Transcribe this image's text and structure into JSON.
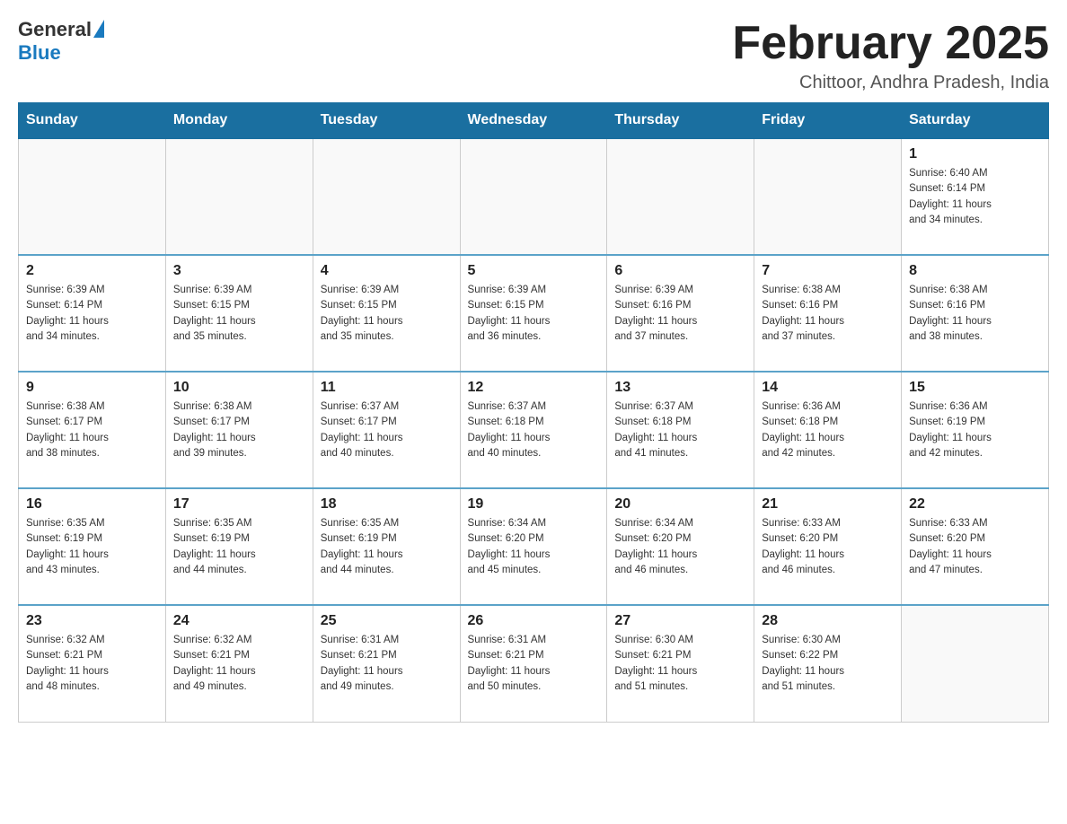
{
  "header": {
    "logo_general": "General",
    "logo_blue": "Blue",
    "title": "February 2025",
    "subtitle": "Chittoor, Andhra Pradesh, India"
  },
  "days_of_week": [
    "Sunday",
    "Monday",
    "Tuesday",
    "Wednesday",
    "Thursday",
    "Friday",
    "Saturday"
  ],
  "weeks": [
    [
      {
        "day": "",
        "info": ""
      },
      {
        "day": "",
        "info": ""
      },
      {
        "day": "",
        "info": ""
      },
      {
        "day": "",
        "info": ""
      },
      {
        "day": "",
        "info": ""
      },
      {
        "day": "",
        "info": ""
      },
      {
        "day": "1",
        "info": "Sunrise: 6:40 AM\nSunset: 6:14 PM\nDaylight: 11 hours\nand 34 minutes."
      }
    ],
    [
      {
        "day": "2",
        "info": "Sunrise: 6:39 AM\nSunset: 6:14 PM\nDaylight: 11 hours\nand 34 minutes."
      },
      {
        "day": "3",
        "info": "Sunrise: 6:39 AM\nSunset: 6:15 PM\nDaylight: 11 hours\nand 35 minutes."
      },
      {
        "day": "4",
        "info": "Sunrise: 6:39 AM\nSunset: 6:15 PM\nDaylight: 11 hours\nand 35 minutes."
      },
      {
        "day": "5",
        "info": "Sunrise: 6:39 AM\nSunset: 6:15 PM\nDaylight: 11 hours\nand 36 minutes."
      },
      {
        "day": "6",
        "info": "Sunrise: 6:39 AM\nSunset: 6:16 PM\nDaylight: 11 hours\nand 37 minutes."
      },
      {
        "day": "7",
        "info": "Sunrise: 6:38 AM\nSunset: 6:16 PM\nDaylight: 11 hours\nand 37 minutes."
      },
      {
        "day": "8",
        "info": "Sunrise: 6:38 AM\nSunset: 6:16 PM\nDaylight: 11 hours\nand 38 minutes."
      }
    ],
    [
      {
        "day": "9",
        "info": "Sunrise: 6:38 AM\nSunset: 6:17 PM\nDaylight: 11 hours\nand 38 minutes."
      },
      {
        "day": "10",
        "info": "Sunrise: 6:38 AM\nSunset: 6:17 PM\nDaylight: 11 hours\nand 39 minutes."
      },
      {
        "day": "11",
        "info": "Sunrise: 6:37 AM\nSunset: 6:17 PM\nDaylight: 11 hours\nand 40 minutes."
      },
      {
        "day": "12",
        "info": "Sunrise: 6:37 AM\nSunset: 6:18 PM\nDaylight: 11 hours\nand 40 minutes."
      },
      {
        "day": "13",
        "info": "Sunrise: 6:37 AM\nSunset: 6:18 PM\nDaylight: 11 hours\nand 41 minutes."
      },
      {
        "day": "14",
        "info": "Sunrise: 6:36 AM\nSunset: 6:18 PM\nDaylight: 11 hours\nand 42 minutes."
      },
      {
        "day": "15",
        "info": "Sunrise: 6:36 AM\nSunset: 6:19 PM\nDaylight: 11 hours\nand 42 minutes."
      }
    ],
    [
      {
        "day": "16",
        "info": "Sunrise: 6:35 AM\nSunset: 6:19 PM\nDaylight: 11 hours\nand 43 minutes."
      },
      {
        "day": "17",
        "info": "Sunrise: 6:35 AM\nSunset: 6:19 PM\nDaylight: 11 hours\nand 44 minutes."
      },
      {
        "day": "18",
        "info": "Sunrise: 6:35 AM\nSunset: 6:19 PM\nDaylight: 11 hours\nand 44 minutes."
      },
      {
        "day": "19",
        "info": "Sunrise: 6:34 AM\nSunset: 6:20 PM\nDaylight: 11 hours\nand 45 minutes."
      },
      {
        "day": "20",
        "info": "Sunrise: 6:34 AM\nSunset: 6:20 PM\nDaylight: 11 hours\nand 46 minutes."
      },
      {
        "day": "21",
        "info": "Sunrise: 6:33 AM\nSunset: 6:20 PM\nDaylight: 11 hours\nand 46 minutes."
      },
      {
        "day": "22",
        "info": "Sunrise: 6:33 AM\nSunset: 6:20 PM\nDaylight: 11 hours\nand 47 minutes."
      }
    ],
    [
      {
        "day": "23",
        "info": "Sunrise: 6:32 AM\nSunset: 6:21 PM\nDaylight: 11 hours\nand 48 minutes."
      },
      {
        "day": "24",
        "info": "Sunrise: 6:32 AM\nSunset: 6:21 PM\nDaylight: 11 hours\nand 49 minutes."
      },
      {
        "day": "25",
        "info": "Sunrise: 6:31 AM\nSunset: 6:21 PM\nDaylight: 11 hours\nand 49 minutes."
      },
      {
        "day": "26",
        "info": "Sunrise: 6:31 AM\nSunset: 6:21 PM\nDaylight: 11 hours\nand 50 minutes."
      },
      {
        "day": "27",
        "info": "Sunrise: 6:30 AM\nSunset: 6:21 PM\nDaylight: 11 hours\nand 51 minutes."
      },
      {
        "day": "28",
        "info": "Sunrise: 6:30 AM\nSunset: 6:22 PM\nDaylight: 11 hours\nand 51 minutes."
      },
      {
        "day": "",
        "info": ""
      }
    ]
  ]
}
